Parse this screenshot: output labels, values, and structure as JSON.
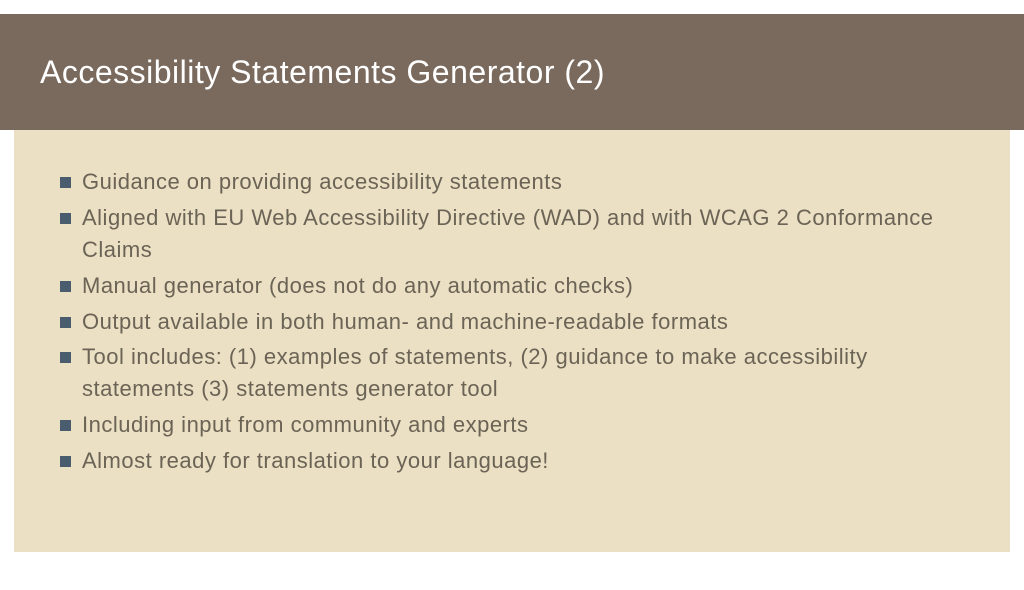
{
  "header": {
    "title": "Accessibility Statements Generator (2)"
  },
  "bullets": [
    "Guidance on providing accessibility statements",
    "Aligned with EU Web Accessibility Directive (WAD) and with WCAG 2 Conformance Claims",
    "Manual generator (does not do any automatic checks)",
    "Output available in both human- and machine-readable formats",
    "Tool includes: (1) examples of statements, (2) guidance to make accessibility statements (3) statements generator tool",
    "Including input from community and experts",
    "Almost ready for translation to your language!"
  ]
}
